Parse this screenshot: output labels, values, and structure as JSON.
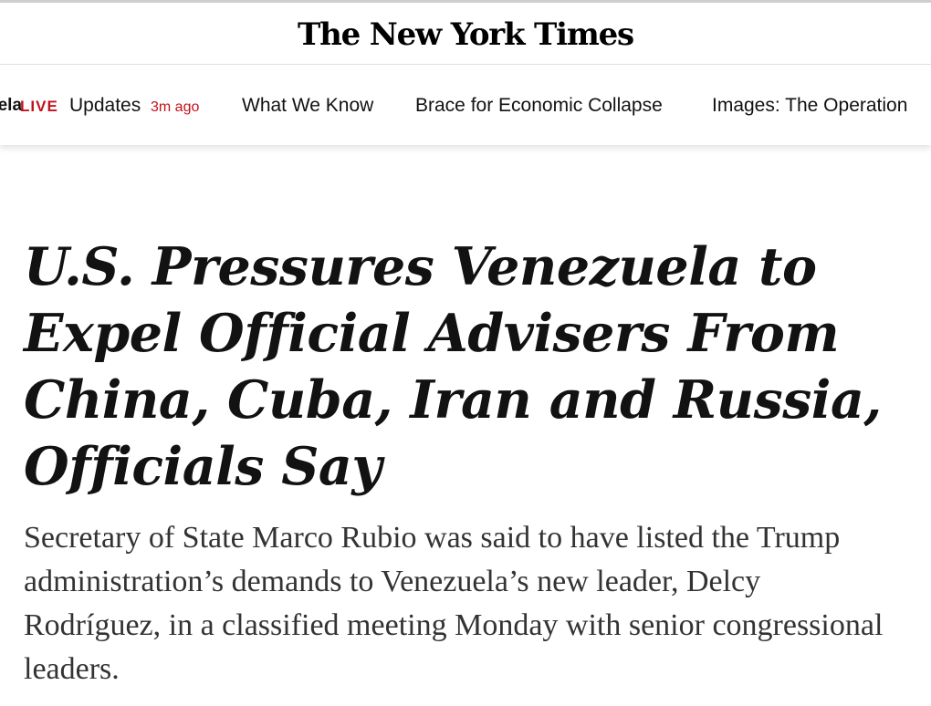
{
  "masthead": {
    "logo_text": "The New York Times"
  },
  "nav": {
    "cut_text": "uela",
    "live_label": "LIVE",
    "live_text": "Updates",
    "live_time": "3m ago",
    "items": [
      {
        "label": "What We Know"
      },
      {
        "label": "Brace for Economic Collapse"
      },
      {
        "label": "Images: The Operation"
      }
    ]
  },
  "article": {
    "headline": "U.S. Pressures Venezuela to Expel Official Advisers From China, Cuba, Iran and Russia, Officials Say",
    "summary": "Secretary of State Marco Rubio was said to have listed the Trump administration’s demands to Venezuela’s new leader, Delcy Rodríguez, in a classified meeting Monday with senior congressional leaders."
  },
  "colors": {
    "live_red": "#c2111d",
    "headline_text": "#121212",
    "summary_text": "#333333"
  }
}
